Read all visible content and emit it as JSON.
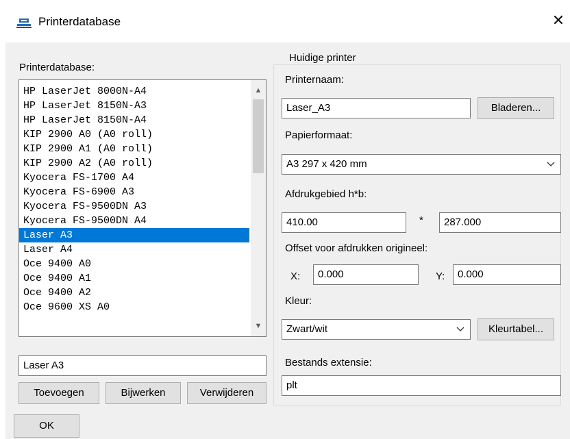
{
  "window": {
    "title": "Printerdatabase",
    "close_glyph": "✕"
  },
  "left": {
    "label": "Printerdatabase:",
    "items": [
      "HP LaserJet 8000N-A4",
      "HP LaserJet 8150N-A3",
      "HP LaserJet 8150N-A4",
      "KIP 2900 A0 (A0 roll)",
      "KIP 2900 A1 (A0 roll)",
      "KIP 2900 A2 (A0 roll)",
      "Kyocera FS-1700 A4",
      "Kyocera FS-6900 A3",
      "Kyocera FS-9500DN A3",
      "Kyocera FS-9500DN A4",
      "Laser A3",
      "Laser A4",
      "Oce 9400 A0",
      "Oce 9400 A1",
      "Oce 9400 A2",
      "Oce 9600 XS A0"
    ],
    "selected_index": 10,
    "name_value": "Laser A3",
    "buttons": {
      "add": "Toevoegen",
      "update": "Bijwerken",
      "delete": "Verwijderen"
    }
  },
  "right": {
    "group_title": "Huidige printer",
    "printer_name_label": "Printernaam:",
    "printer_name_value": "Laser_A3",
    "browse_label": "Bladeren...",
    "paper_label": "Papierformaat:",
    "paper_value": "A3 297 x 420 mm",
    "area_label": "Afdrukgebied h*b:",
    "area_h": "410.00",
    "area_sep": "*",
    "area_w": "287.000",
    "offset_label": "Offset voor afdrukken origineel:",
    "offset_x_label": "X:",
    "offset_x_value": "0.000",
    "offset_y_label": "Y:",
    "offset_y_value": "0.000",
    "color_label": "Kleur:",
    "color_value": "Zwart/wit",
    "color_table_label": "Kleurtabel...",
    "ext_label": "Bestands extensie:",
    "ext_value": "plt"
  },
  "footer": {
    "ok_label": "OK"
  },
  "icons": {
    "app": "printer-app-icon",
    "close": "close-icon",
    "scroll_up": "scroll-up-icon",
    "scroll_down": "scroll-down-icon",
    "combo": "chevron-down-icon"
  },
  "colors": {
    "selection": "#0078d7",
    "dialog_bg": "#f0f0f0",
    "button_bg": "#e1e1e1"
  }
}
